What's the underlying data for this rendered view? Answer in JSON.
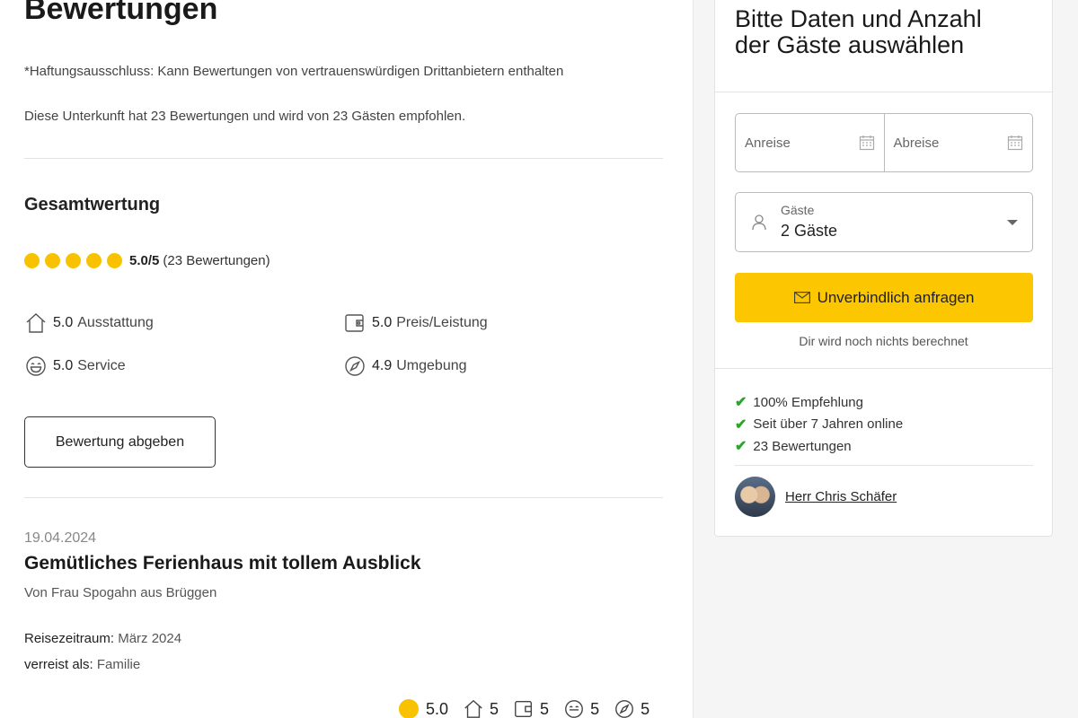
{
  "main": {
    "title": "Bewertungen",
    "disclaimer": "*Haftungsausschluss: Kann Bewertungen von vertrauenswürdigen Drittanbietern enthalten",
    "summary": "Diese Unterkunft hat 23 Bewertungen und wird von 23 Gästen empfohlen.",
    "overall": {
      "heading": "Gesamtwertung",
      "value": "5.0/5",
      "count": "(23 Bewertungen)",
      "stars": 5
    },
    "categories": [
      {
        "icon": "house-icon",
        "score": "5.0",
        "label": "Ausstattung"
      },
      {
        "icon": "wallet-icon",
        "score": "5.0",
        "label": "Preis/Leistung"
      },
      {
        "icon": "smiley-icon",
        "score": "5.0",
        "label": "Service"
      },
      {
        "icon": "compass-icon",
        "score": "4.9",
        "label": "Umgebung"
      }
    ],
    "review_button": "Bewertung abgeben",
    "review": {
      "date": "19.04.2024",
      "title": "Gemütliches Ferienhaus mit tollem Ausblick",
      "author": "Von Frau Spogahn aus Brüggen",
      "travel_period_label": "Reisezeitraum:",
      "travel_period": "März 2024",
      "travel_type_label": "verreist als:",
      "travel_type": "Familie",
      "ratings": [
        {
          "icon": "sun-icon",
          "value": "5.0"
        },
        {
          "icon": "house-icon",
          "value": "5"
        },
        {
          "icon": "wallet-icon",
          "value": "5"
        },
        {
          "icon": "smiley-icon",
          "value": "5"
        },
        {
          "icon": "compass-icon",
          "value": "5"
        }
      ]
    }
  },
  "sidebar": {
    "title": "Bitte Daten und Anzahl der Gäste auswählen",
    "arrival_placeholder": "Anreise",
    "departure_placeholder": "Abreise",
    "guests_label": "Gäste",
    "guests_value": "2 Gäste",
    "enquiry_button": "Unverbindlich anfragen",
    "no_charge": "Dir wird noch nichts berechnet",
    "benefits": [
      "100% Empfehlung",
      "Seit über 7 Jahren online",
      "23 Bewertungen"
    ],
    "host_name": "Herr Chris Schäfer"
  },
  "colors": {
    "accent": "#fcc600",
    "star": "#f8c200",
    "check": "#2aa52a"
  }
}
